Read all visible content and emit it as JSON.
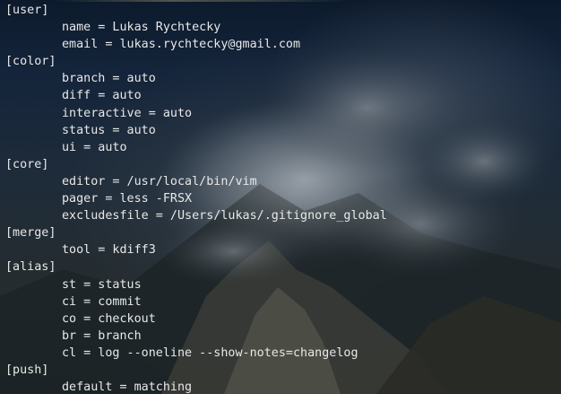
{
  "terminal": {
    "lines": [
      {
        "kind": "section",
        "text": "[user]"
      },
      {
        "kind": "entry",
        "text": "name = Lukas Rychtecky"
      },
      {
        "kind": "entry",
        "text": "email = lukas.rychtecky@gmail.com"
      },
      {
        "kind": "section",
        "text": "[color]"
      },
      {
        "kind": "entry",
        "text": "branch = auto"
      },
      {
        "kind": "entry",
        "text": "diff = auto"
      },
      {
        "kind": "entry",
        "text": "interactive = auto"
      },
      {
        "kind": "entry",
        "text": "status = auto"
      },
      {
        "kind": "entry",
        "text": "ui = auto"
      },
      {
        "kind": "section",
        "text": "[core]"
      },
      {
        "kind": "entry",
        "text": "editor = /usr/local/bin/vim"
      },
      {
        "kind": "entry",
        "text": "pager = less -FRSX"
      },
      {
        "kind": "entry",
        "text": "excludesfile = /Users/lukas/.gitignore_global"
      },
      {
        "kind": "section",
        "text": "[merge]"
      },
      {
        "kind": "entry",
        "text": "tool = kdiff3"
      },
      {
        "kind": "section",
        "text": "[alias]"
      },
      {
        "kind": "entry",
        "text": "st = status"
      },
      {
        "kind": "entry",
        "text": "ci = commit"
      },
      {
        "kind": "entry",
        "text": "co = checkout"
      },
      {
        "kind": "entry",
        "text": "br = branch"
      },
      {
        "kind": "entry",
        "text": "cl = log --oneline --show-notes=changelog"
      },
      {
        "kind": "section",
        "text": "[push]"
      },
      {
        "kind": "entry",
        "text": "default = matching"
      }
    ]
  }
}
